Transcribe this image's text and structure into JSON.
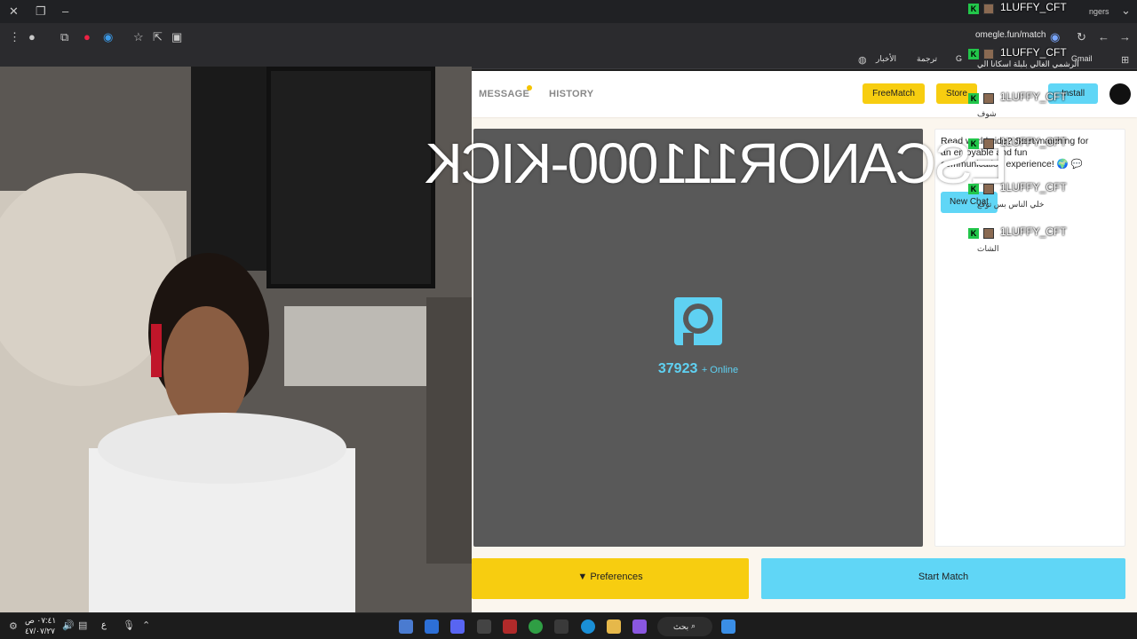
{
  "browser": {
    "url": "omegle.fun/match",
    "tab_partial_text": "ngers",
    "bookmarks": [
      {
        "label": "Gmail"
      },
      {
        "label": "G"
      },
      {
        "label": "ترجمة"
      },
      {
        "label": "الأخبار"
      }
    ]
  },
  "navbar": {
    "message_label": "MESSAGE",
    "history_label": "HISTORY",
    "freematch_label": "FreeMatch",
    "store_label": "Store",
    "install_label": "Install"
  },
  "match": {
    "online_count": "37923",
    "online_suffix": "+ Online"
  },
  "chat": {
    "intro": "Ready to meet people worldwide? Start matching for an enjoyable and fun communication experience! 🌍💬",
    "intro_visible": "Read worldwide? Start matching for an enjoyable and fun communication experience! 🌍 💬",
    "new_chat_label": "New Chat"
  },
  "controls": {
    "preferences_label": "Preferences",
    "start_match_label": "Start Match"
  },
  "overlay": {
    "mirrored_text": "ESCANOR111000-KICK",
    "feed": [
      {
        "badge": "K",
        "user": "1LUFFY_CFT",
        "message": ""
      },
      {
        "badge": "K",
        "user": "1LUFFY_CFT",
        "message": "الرشمي الغالي بلبلة اسكانا الي"
      },
      {
        "badge": "K",
        "user": "1LUFFY_CFT",
        "message": "شوف"
      },
      {
        "badge": "K",
        "user": "1LUFFY_CFT",
        "message": ""
      },
      {
        "badge": "K",
        "user": "1LUFFY_CFT",
        "message": "خلي الناس بس توقع"
      },
      {
        "badge": "K",
        "user": "1LUFFY_CFT",
        "message": "الشات"
      }
    ]
  },
  "taskbar": {
    "time": "٠٧:٤١ ص",
    "date": "٤٧/٠٧/٢٧",
    "lang": "ع",
    "search_label": "بحث"
  },
  "colors": {
    "yellow": "#f7cd10",
    "cyan": "#60d6f6",
    "kick_green": "#22c64a"
  }
}
